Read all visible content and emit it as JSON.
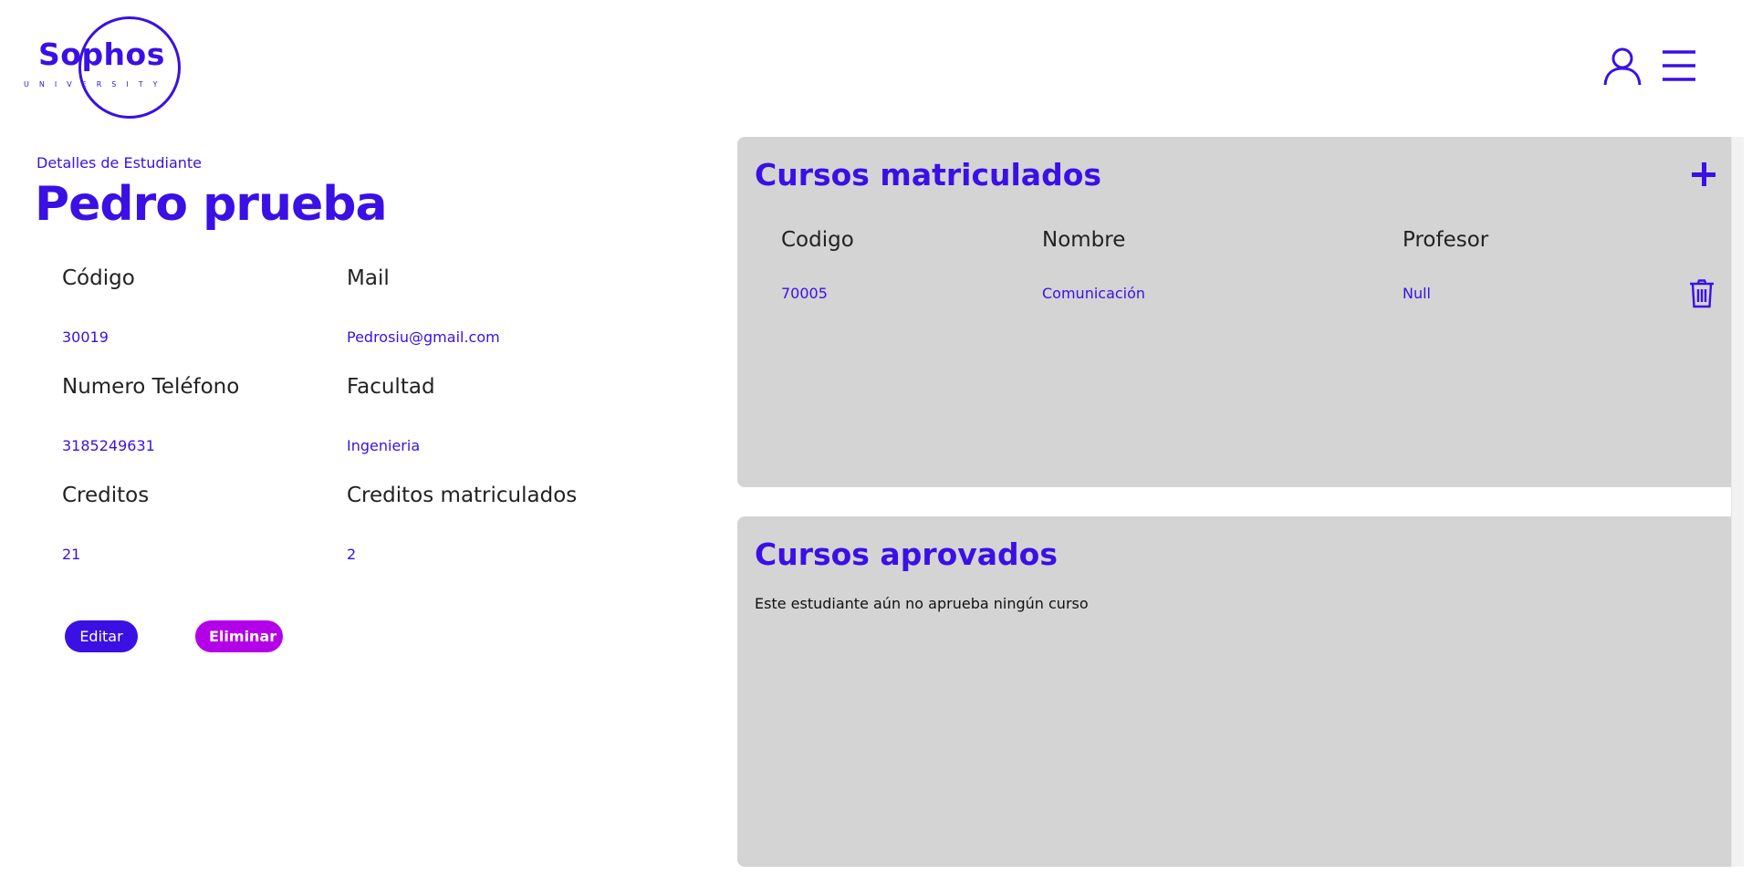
{
  "logo": {
    "name": "Sophos",
    "sub": "UNIVERSITY"
  },
  "header": {
    "icons": [
      "user-icon",
      "menu-icon"
    ]
  },
  "student": {
    "breadcrumb": "Detalles de Estudiante",
    "name": "Pedro prueba",
    "fields": [
      {
        "label": "Código",
        "value": "30019"
      },
      {
        "label": "Mail",
        "value": "Pedrosiu@gmail.com"
      },
      {
        "label": "Numero Teléfono",
        "value": "3185249631"
      },
      {
        "label": "Facultad",
        "value": "Ingenieria"
      },
      {
        "label": "Creditos",
        "value": "21"
      },
      {
        "label": "Creditos matriculados",
        "value": "2"
      }
    ],
    "buttons": {
      "edit": "Editar",
      "delete": "Eliminar"
    }
  },
  "enrolled": {
    "title": "Cursos matriculados",
    "columns": [
      "Codigo",
      "Nombre",
      "Profesor"
    ],
    "rows": [
      {
        "codigo": "70005",
        "nombre": "Comunicación",
        "profesor": "Null"
      }
    ]
  },
  "approved": {
    "title": "Cursos aprovados",
    "empty_message": "Este estudiante aún no aprueba ningún curso"
  },
  "colors": {
    "primary": "#3a10e5",
    "danger": "#b400e8",
    "panel": "#d4d4d4"
  }
}
